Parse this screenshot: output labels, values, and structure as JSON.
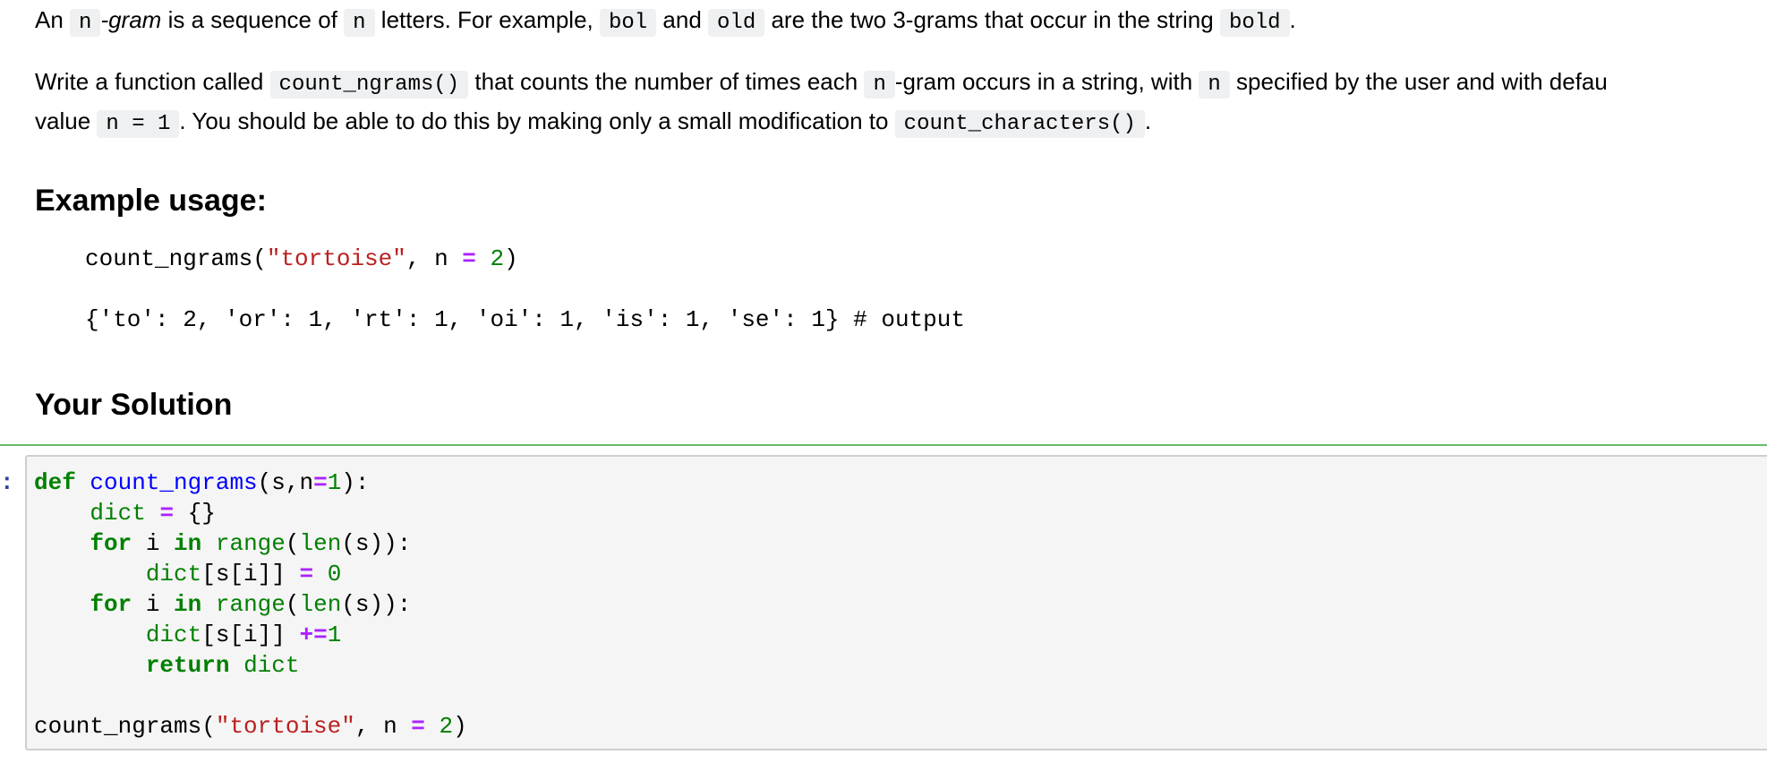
{
  "intro": {
    "p1": {
      "t1": "An ",
      "c1": "n",
      "t2_italic": "-gram",
      "t3": " is a sequence of ",
      "c2": "n",
      "t4": " letters. For example, ",
      "c3": "bol",
      "t5": " and ",
      "c4": "old",
      "t6": " are the two 3-grams that occur in the string ",
      "c5": "bold",
      "t7": "."
    },
    "p2": {
      "t1": "Write a function called ",
      "c1": "count_ngrams()",
      "t2": " that counts the number of times each ",
      "c2": "n",
      "t3": "-gram occurs in a string, with ",
      "c3": "n",
      "t4": " specified by the user and with defau"
    },
    "p3": {
      "t1": "value ",
      "c1": "n = 1",
      "t2": ". You should be able to do this by making only a small modification to ",
      "c2": "count_characters()",
      "t3": "."
    }
  },
  "example": {
    "heading": "Example usage:",
    "call": {
      "fn": "count_ngrams(",
      "arg": "\"tortoise\"",
      "mid": ", n ",
      "eq": "=",
      "sp": " ",
      "num": "2",
      "close": ")"
    },
    "output": "{'to': 2, 'or': 1, 'rt': 1, 'oi': 1, 'is': 1, 'se': 1} # output"
  },
  "solution": {
    "heading": "Your Solution",
    "prompt": ":",
    "code_lines": [
      [
        {
          "c": "kw",
          "t": "def"
        },
        {
          "c": "",
          "t": " "
        },
        {
          "c": "fn",
          "t": "count_ngrams"
        },
        {
          "c": "",
          "t": "(s,n"
        },
        {
          "c": "op",
          "t": "="
        },
        {
          "c": "num",
          "t": "1"
        },
        {
          "c": "",
          "t": "):"
        }
      ],
      [
        {
          "c": "",
          "t": "    "
        },
        {
          "c": "bi",
          "t": "dict"
        },
        {
          "c": "",
          "t": " "
        },
        {
          "c": "op",
          "t": "="
        },
        {
          "c": "",
          "t": " {}"
        }
      ],
      [
        {
          "c": "",
          "t": "    "
        },
        {
          "c": "kw",
          "t": "for"
        },
        {
          "c": "",
          "t": " i "
        },
        {
          "c": "kw",
          "t": "in"
        },
        {
          "c": "",
          "t": " "
        },
        {
          "c": "bi",
          "t": "range"
        },
        {
          "c": "",
          "t": "("
        },
        {
          "c": "bi",
          "t": "len"
        },
        {
          "c": "",
          "t": "(s)):"
        }
      ],
      [
        {
          "c": "",
          "t": "        "
        },
        {
          "c": "bi",
          "t": "dict"
        },
        {
          "c": "",
          "t": "[s[i]] "
        },
        {
          "c": "op",
          "t": "="
        },
        {
          "c": "",
          "t": " "
        },
        {
          "c": "num",
          "t": "0"
        }
      ],
      [
        {
          "c": "",
          "t": "    "
        },
        {
          "c": "kw",
          "t": "for"
        },
        {
          "c": "",
          "t": " i "
        },
        {
          "c": "kw",
          "t": "in"
        },
        {
          "c": "",
          "t": " "
        },
        {
          "c": "bi",
          "t": "range"
        },
        {
          "c": "",
          "t": "("
        },
        {
          "c": "bi",
          "t": "len"
        },
        {
          "c": "",
          "t": "(s)):"
        }
      ],
      [
        {
          "c": "",
          "t": "        "
        },
        {
          "c": "bi",
          "t": "dict"
        },
        {
          "c": "",
          "t": "[s[i]] "
        },
        {
          "c": "op",
          "t": "+="
        },
        {
          "c": "num",
          "t": "1"
        }
      ],
      [
        {
          "c": "",
          "t": "        "
        },
        {
          "c": "kw",
          "t": "return"
        },
        {
          "c": "",
          "t": " "
        },
        {
          "c": "bi",
          "t": "dict"
        }
      ],
      [
        {
          "c": "",
          "t": ""
        }
      ],
      [
        {
          "c": "",
          "t": "count_ngrams("
        },
        {
          "c": "str",
          "t": "\"tortoise\""
        },
        {
          "c": "",
          "t": ", n "
        },
        {
          "c": "op",
          "t": "="
        },
        {
          "c": "",
          "t": " "
        },
        {
          "c": "num",
          "t": "2"
        },
        {
          "c": "",
          "t": ")"
        }
      ]
    ]
  }
}
